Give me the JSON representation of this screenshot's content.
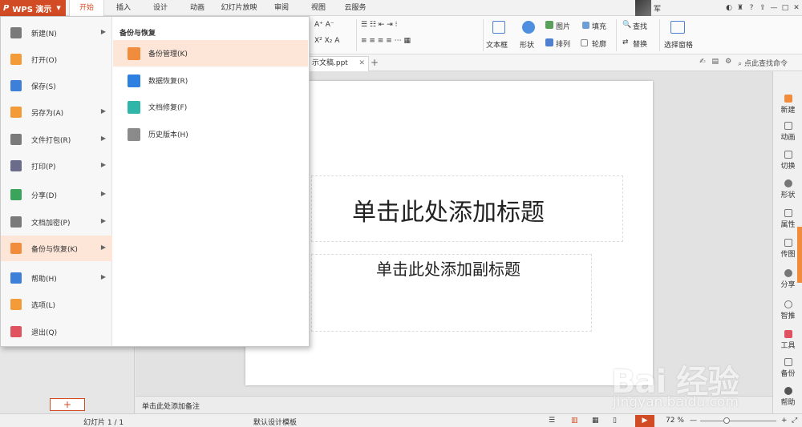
{
  "app": {
    "wps_label": "WPS 演示",
    "username": "军"
  },
  "tabs": [
    "开始",
    "插入",
    "设计",
    "动画",
    "幻灯片放映",
    "审阅",
    "视图",
    "云服务"
  ],
  "active_tab": "开始",
  "window_controls": [
    "—",
    "□",
    "✕"
  ],
  "ribbon": {
    "textbox": "文本框",
    "shape": "形状",
    "picture": "图片",
    "fill": "填充",
    "arrange": "排列",
    "outline": "轮廓",
    "find": "查找",
    "replace": "替换",
    "selection_pane": "选择窗格"
  },
  "document_tab": {
    "name": "示文稿.ppt",
    "close": "✕",
    "add": "+"
  },
  "search_hint": "点此查找命令",
  "slide": {
    "title_placeholder": "单击此处添加标题",
    "subtitle_placeholder": "单击此处添加副标题"
  },
  "notes_placeholder": "单击此处添加备注",
  "add_slide_label": "+",
  "side_panel": [
    "新建",
    "动画",
    "切换",
    "形状",
    "属性",
    "传图",
    "分享",
    "智推",
    "工具",
    "备份",
    "帮助"
  ],
  "status_bar": {
    "slide_counter": "幻灯片 1 / 1",
    "template": "默认设计模板",
    "zoom": "72 %",
    "zoom_level_fraction": 0.35
  },
  "file_menu": {
    "items": [
      {
        "label": "新建(N)",
        "icon": "new-file-icon",
        "has_submenu": true,
        "color": "#7a7a7a"
      },
      {
        "label": "打开(O)",
        "icon": "open-folder-icon",
        "has_submenu": false,
        "color": "#f29b38"
      },
      {
        "label": "保存(S)",
        "icon": "save-icon",
        "has_submenu": false,
        "color": "#3d7fd9"
      },
      {
        "label": "另存为(A)",
        "icon": "save-as-icon",
        "has_submenu": true,
        "color": "#f29b38"
      },
      {
        "label": "文件打包(R)",
        "icon": "package-icon",
        "has_submenu": true,
        "color": "#7a7a7a"
      },
      {
        "label": "打印(P)",
        "icon": "print-icon",
        "has_submenu": true,
        "color": "#6b6b8a"
      },
      {
        "label": "分享(D)",
        "icon": "share-icon",
        "has_submenu": true,
        "color": "#3aa55a"
      },
      {
        "label": "文档加密(P)",
        "icon": "encrypt-icon",
        "has_submenu": true,
        "color": "#7a7a7a"
      },
      {
        "label": "备份与恢复(K)",
        "icon": "backup-icon",
        "has_submenu": true,
        "color": "#f08c3c"
      },
      {
        "label": "帮助(H)",
        "icon": "help-icon",
        "has_submenu": true,
        "color": "#3d7fd9"
      },
      {
        "label": "选项(L)",
        "icon": "options-gear-icon",
        "has_submenu": false,
        "color": "#f29b38"
      },
      {
        "label": "退出(Q)",
        "icon": "exit-icon",
        "has_submenu": false,
        "color": "#e0525f"
      }
    ],
    "active_item": "备份与恢复(K)",
    "submenu_title": "备份与恢复",
    "submenu_items": [
      {
        "label": "备份管理(K)",
        "icon": "backup-manage-icon",
        "color": "#f08c3c"
      },
      {
        "label": "数据恢复(R)",
        "icon": "data-recovery-icon",
        "color": "#2d7fe0"
      },
      {
        "label": "文档修复(F)",
        "icon": "doc-repair-icon",
        "color": "#2fb6a8"
      },
      {
        "label": "历史版本(H)",
        "icon": "history-version-icon",
        "color": "#8a8a8a"
      }
    ],
    "active_submenu_item": "备份管理(K)"
  },
  "watermark": {
    "text": "Bai 经验",
    "url": "jingyan.baidu.com"
  },
  "colors": {
    "accent": "#d14b24",
    "menu_highlight": "#fde6d8",
    "side_orange": "#f08c3c"
  }
}
